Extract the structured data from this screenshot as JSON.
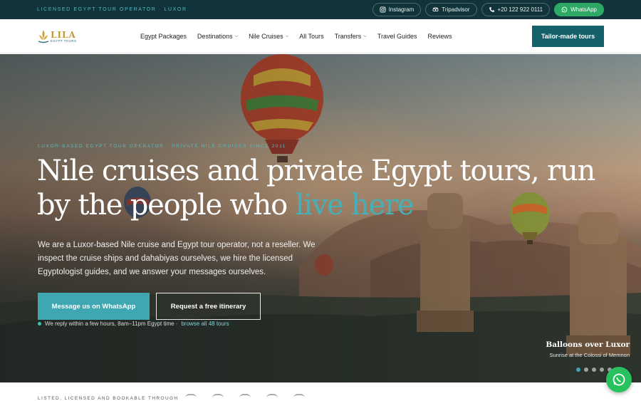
{
  "topbar": {
    "tagline": "LICENSED EGYPT TOUR OPERATOR · LUXOR",
    "instagram": "Instagram",
    "tripadvisor": "Tripadvisor",
    "phone": "+20 122 922 0111",
    "whatsapp": "WhatsApp"
  },
  "logo": {
    "name": "LILA",
    "sub": "EGYPT TOURS"
  },
  "nav": {
    "items": [
      {
        "label": "Egypt Packages",
        "dropdown": false
      },
      {
        "label": "Destinations",
        "dropdown": true
      },
      {
        "label": "Nile Cruises",
        "dropdown": true
      },
      {
        "label": "All Tours",
        "dropdown": false
      },
      {
        "label": "Transfers",
        "dropdown": true
      },
      {
        "label": "Travel Guides",
        "dropdown": false
      },
      {
        "label": "Reviews",
        "dropdown": false
      }
    ],
    "cta": "Tailor-made tours"
  },
  "hero": {
    "eyebrow": "LUXOR-BASED EGYPT TOUR OPERATOR · PRIVATE NILE CRUISES SINCE 2011",
    "headline_main": "Nile cruises and private Egypt tours, run by the people who ",
    "headline_accent": "live here",
    "lead": "We are a Luxor-based Nile cruise and Egypt tour operator, not a reseller. We inspect the cruise ships and dahabiyas ourselves, we hire the licensed Egyptologist guides, and we answer your messages ourselves.",
    "primary_button": "Message us on WhatsApp",
    "secondary_button": "Request a free itinerary",
    "reply_note": "We reply within a few hours, 8am–11pm Egypt time ·",
    "reply_link": "browse all 48 tours",
    "caption_title": "Balloons over Luxor",
    "caption_sub": "Sunrise at the Colossi of Memnon",
    "slides": 6,
    "active_slide": 1
  },
  "strip": {
    "label": "LISTED, LICENSED AND BOOKABLE THROUGH"
  },
  "colors": {
    "topbar": "#10343a",
    "accent": "#3ea7b2",
    "cta": "#15616b",
    "whatsapp": "#27c25e"
  }
}
